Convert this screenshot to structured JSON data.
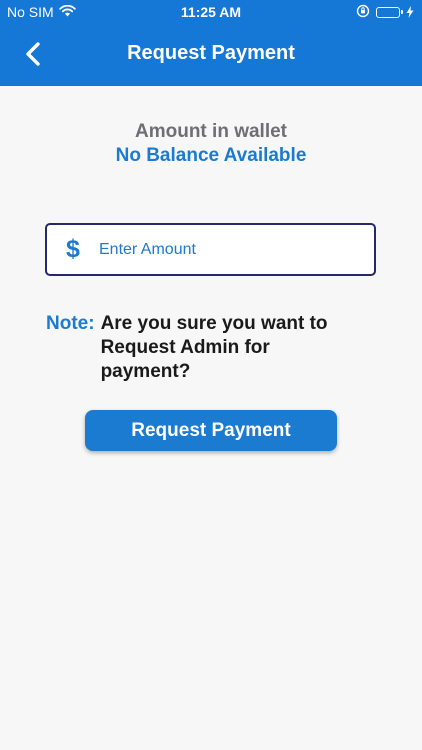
{
  "status_bar": {
    "carrier": "No SIM",
    "time": "11:25 AM"
  },
  "nav": {
    "title": "Request Payment",
    "back_icon": "chevron-left-icon"
  },
  "wallet": {
    "label": "Amount in wallet",
    "value": "No Balance Available"
  },
  "amount_field": {
    "icon": "dollar-sign-icon",
    "symbol": "$",
    "placeholder": "Enter Amount",
    "value": ""
  },
  "note": {
    "label": "Note:",
    "text": "Are you sure you want to Request Admin for payment?"
  },
  "request_button": {
    "label": "Request Payment"
  },
  "colors": {
    "header_bg": "#1577d6",
    "accent": "#1a7bd1",
    "input_border": "#24296a",
    "page_bg": "#f7f7f8",
    "battery": "#4cd964"
  }
}
